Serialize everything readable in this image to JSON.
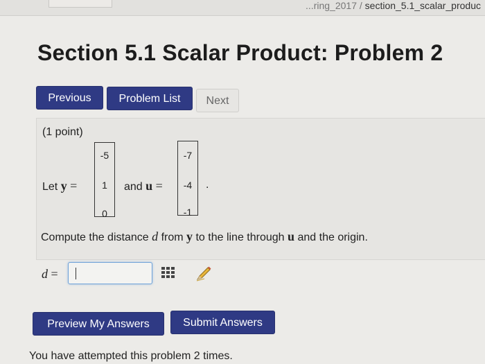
{
  "browser": {
    "breadcrumb_prefix": "...ring_2017 /",
    "breadcrumb_current": "section_5.1_scalar_produc"
  },
  "page": {
    "title": "Section 5.1 Scalar Product: Problem 2"
  },
  "nav": {
    "previous_label": "Previous",
    "problem_list_label": "Problem List",
    "next_label": "Next"
  },
  "problem": {
    "points": "(1 point)",
    "let_text": "Let",
    "y_var": "y",
    "equals": "=",
    "and_text": "and",
    "u_var": "u",
    "period": ".",
    "vector_y": [
      "-5",
      "1",
      "0"
    ],
    "vector_u": [
      "-7",
      "-4",
      "-1"
    ],
    "question_part1": "Compute the distance",
    "question_d": "d",
    "question_part2": "from",
    "question_y": "y",
    "question_part3": "to the line through",
    "question_u": "u",
    "question_part4": "and the origin.",
    "answer_label_var": "d",
    "answer_label_eq": "=",
    "answer_value": ""
  },
  "actions": {
    "preview_label": "Preview My Answers",
    "submit_label": "Submit Answers"
  },
  "status": {
    "attempts_text": "You have attempted this problem 2 times."
  },
  "colors": {
    "primary_button": "#2f3a84",
    "input_focus_border": "#6fa2d8"
  },
  "icons": {
    "matrix_input": "grid-icon",
    "edit": "pencil-icon"
  }
}
